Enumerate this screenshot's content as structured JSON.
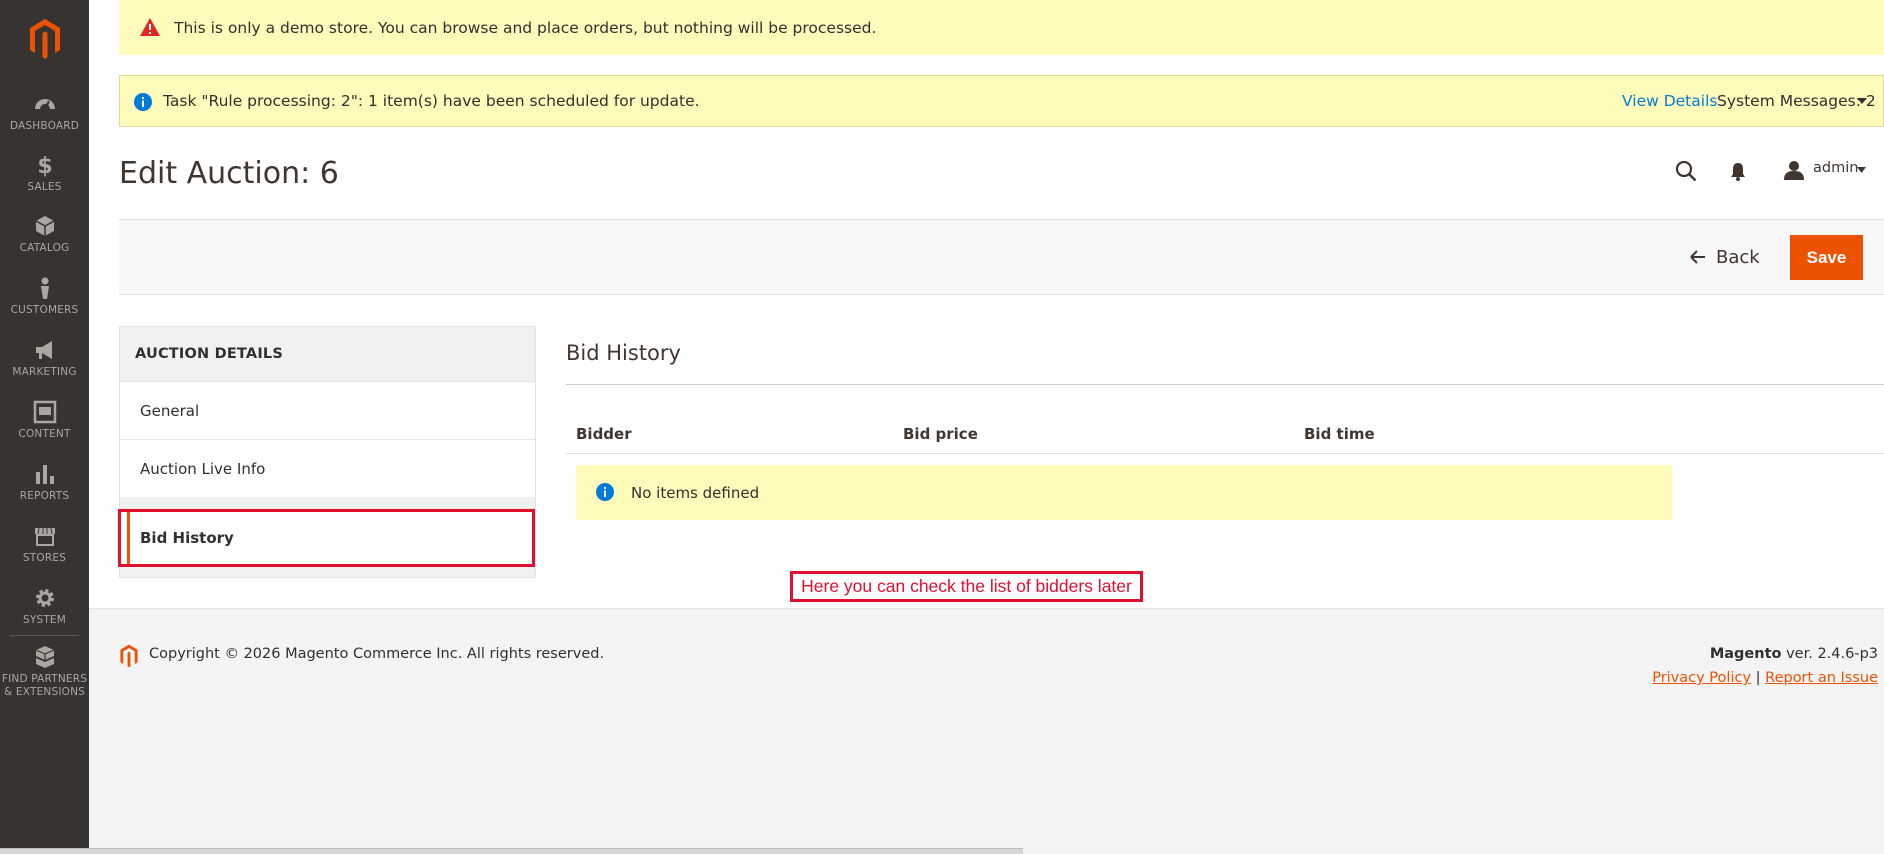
{
  "colors": {
    "accent": "#eb5202",
    "sidebar": "#373330",
    "message_bg": "#fffbbb",
    "info_blue": "#007bdb",
    "annotation_red": "#e0102e"
  },
  "sidebar": {
    "logo": "magento-logo",
    "items": [
      {
        "label": "DASHBOARD",
        "icon": "dashboard-icon"
      },
      {
        "label": "SALES",
        "icon": "dollar-icon"
      },
      {
        "label": "CATALOG",
        "icon": "cube-icon"
      },
      {
        "label": "CUSTOMERS",
        "icon": "person-icon"
      },
      {
        "label": "MARKETING",
        "icon": "megaphone-icon"
      },
      {
        "label": "CONTENT",
        "icon": "content-icon"
      },
      {
        "label": "REPORTS",
        "icon": "bar-chart-icon"
      },
      {
        "label": "STORES",
        "icon": "store-icon"
      },
      {
        "label": "SYSTEM",
        "icon": "gear-icon"
      },
      {
        "label": "FIND PARTNERS",
        "label2": "& EXTENSIONS",
        "icon": "boxes-icon"
      }
    ]
  },
  "messages": {
    "demo": "This is only a demo store. You can browse and place orders, but nothing will be processed.",
    "task": "Task \"Rule processing: 2\": 1 item(s) have been scheduled for update.",
    "view_details": "View Details",
    "system_messages": "System Messages: 2"
  },
  "header": {
    "title": "Edit Auction: 6",
    "user": "admin"
  },
  "actions": {
    "back": "Back",
    "save": "Save"
  },
  "tabs": {
    "title": "AUCTION DETAILS",
    "items": [
      {
        "label": "General"
      },
      {
        "label": "Auction Live Info"
      },
      {
        "label": "Bid History",
        "active": true
      }
    ]
  },
  "main": {
    "section_title": "Bid History",
    "columns": [
      "Bidder",
      "Bid price",
      "Bid time"
    ],
    "empty_message": "No items defined",
    "annotation": "Here you can check the list of bidders later"
  },
  "footer": {
    "copyright": "Copyright © 2026 Magento Commerce Inc. All rights reserved.",
    "brand": "Magento",
    "version": " ver. 2.4.6-p3",
    "privacy": "Privacy Policy",
    "separator": "|",
    "report": "Report an Issue"
  }
}
